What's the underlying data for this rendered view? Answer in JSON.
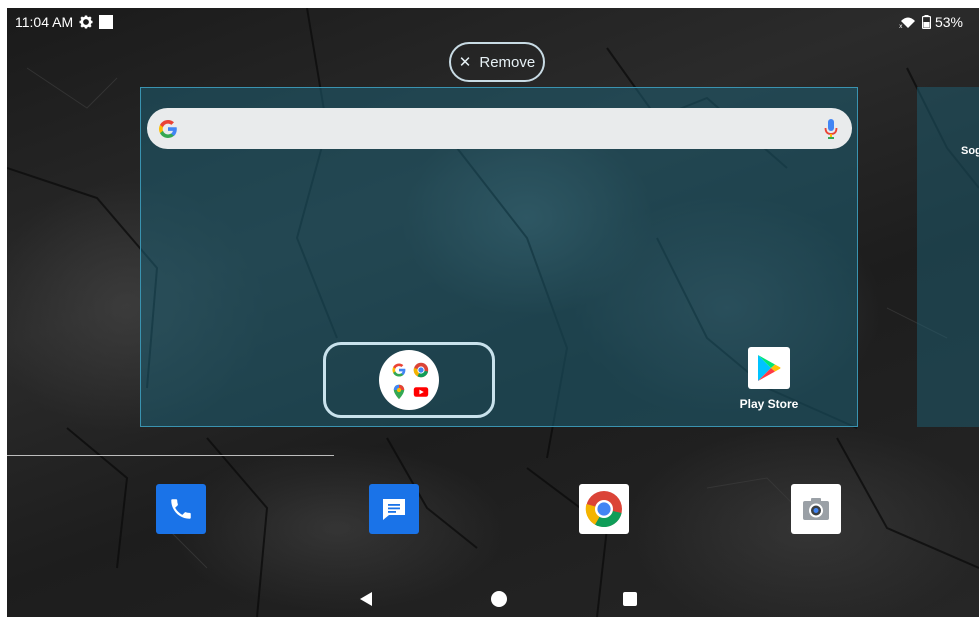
{
  "status_bar": {
    "time": "11:04 AM",
    "battery": "53%",
    "icons": [
      "settings-gear-icon",
      "notification-square-icon",
      "wifi-x-icon",
      "battery-icon"
    ]
  },
  "remove": {
    "label": "Remove",
    "icon": "close-icon"
  },
  "search_widget": {
    "icons": [
      "google-g-icon",
      "microphone-icon"
    ]
  },
  "next_page": {
    "label_fragment": "Sog"
  },
  "folder": {
    "apps": [
      "Google",
      "Chrome",
      "Maps",
      "YouTube"
    ]
  },
  "play_store": {
    "label": "Play Store"
  },
  "dock": {
    "apps": [
      "Phone",
      "Messages",
      "Chrome",
      "Camera"
    ]
  },
  "colors": {
    "page_highlight": "#1e5f73",
    "phone_blue": "#1a73e8",
    "messages_blue": "#1a73e8"
  }
}
